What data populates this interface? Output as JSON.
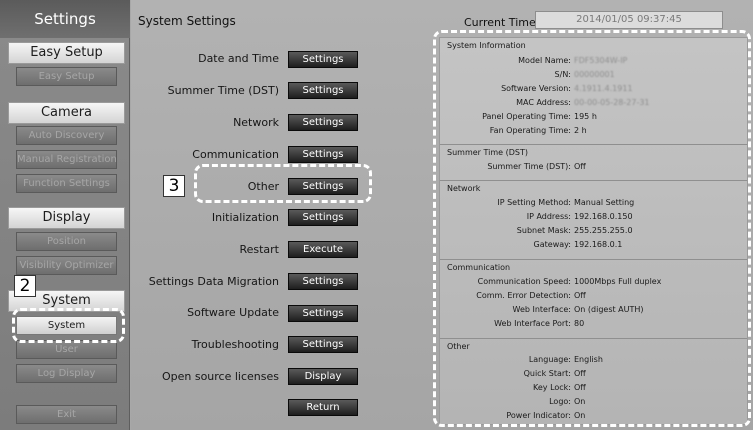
{
  "sidebar": {
    "title": "Settings",
    "sections": [
      {
        "header": "Easy Setup",
        "items": [
          "Easy Setup"
        ]
      },
      {
        "header": "Camera",
        "items": [
          "Auto Discovery",
          "Manual Registration",
          "Function Settings"
        ]
      },
      {
        "header": "Display",
        "items": [
          "Position",
          "Visibility Optimizer"
        ]
      },
      {
        "header": "System",
        "items": [
          "System",
          "User",
          "Log Display",
          "Exit"
        ]
      }
    ]
  },
  "callouts": {
    "sidebar_number": "2",
    "main_number": "3"
  },
  "main": {
    "title": "System Settings",
    "current_time_label": "Current Time",
    "current_time_value": "2014/01/05 09:37:45",
    "rows": [
      {
        "label": "Date and Time",
        "button": "Settings"
      },
      {
        "label": "Summer Time (DST)",
        "button": "Settings"
      },
      {
        "label": "Network",
        "button": "Settings"
      },
      {
        "label": "Communication",
        "button": "Settings"
      },
      {
        "label": "Other",
        "button": "Settings"
      },
      {
        "label": "Initialization",
        "button": "Settings"
      },
      {
        "label": "Restart",
        "button": "Execute"
      },
      {
        "label": "Settings Data Migration",
        "button": "Settings"
      },
      {
        "label": "Software Update",
        "button": "Settings"
      },
      {
        "label": "Troubleshooting",
        "button": "Settings"
      },
      {
        "label": "Open source licenses",
        "button": "Display"
      }
    ],
    "return_button": "Return"
  },
  "info": {
    "groups": [
      {
        "title": "System Information",
        "rows": [
          {
            "label": "Model Name:",
            "value": "FDF5304W-IP"
          },
          {
            "label": "S/N:",
            "value": "00000001"
          },
          {
            "label": "Software Version:",
            "value": "4.1911.4.1911"
          },
          {
            "label": "MAC Address:",
            "value": "00-00-05-28-27-31"
          },
          {
            "label": "Panel Operating Time:",
            "value": "195 h"
          },
          {
            "label": "Fan Operating Time:",
            "value": "2 h"
          }
        ]
      },
      {
        "title": "Summer Time (DST)",
        "rows": [
          {
            "label": "Summer Time (DST):",
            "value": "Off"
          }
        ]
      },
      {
        "title": "Network",
        "rows": [
          {
            "label": "IP Setting Method:",
            "value": "Manual Setting"
          },
          {
            "label": "IP Address:",
            "value": "192.168.0.150"
          },
          {
            "label": "Subnet Mask:",
            "value": "255.255.255.0"
          },
          {
            "label": "Gateway:",
            "value": "192.168.0.1"
          }
        ]
      },
      {
        "title": "Communication",
        "rows": [
          {
            "label": "Communication Speed:",
            "value": "1000Mbps Full duplex"
          },
          {
            "label": "Comm. Error Detection:",
            "value": "Off"
          },
          {
            "label": "Web Interface:",
            "value": "On (digest AUTH)"
          },
          {
            "label": "Web Interface Port:",
            "value": "80"
          }
        ]
      },
      {
        "title": "Other",
        "rows": [
          {
            "label": "Language:",
            "value": "English"
          },
          {
            "label": "Quick Start:",
            "value": "Off"
          },
          {
            "label": "Key Lock:",
            "value": "Off"
          },
          {
            "label": "Logo:",
            "value": "On"
          },
          {
            "label": "Power Indicator:",
            "value": "On"
          }
        ]
      }
    ]
  }
}
